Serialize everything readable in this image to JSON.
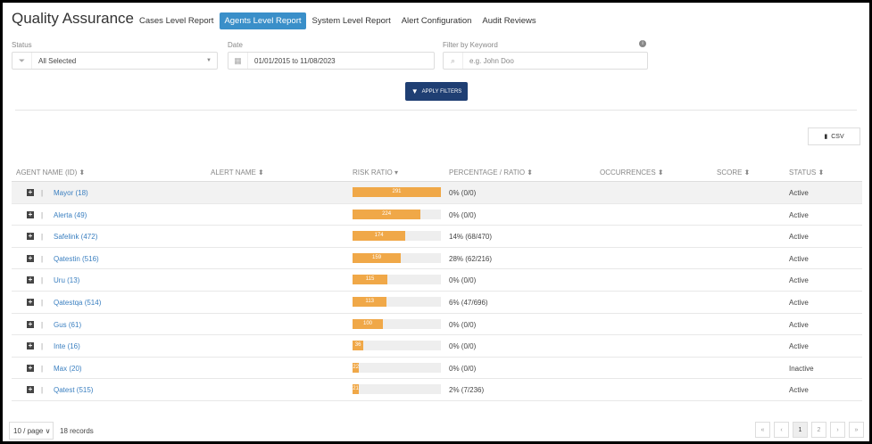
{
  "header": {
    "title": "Quality Assurance",
    "tabs": [
      {
        "label": "Cases Level Report"
      },
      {
        "label": "Agents Level Report",
        "active": true
      },
      {
        "label": "System Level Report"
      },
      {
        "label": "Alert Configuration"
      },
      {
        "label": "Audit Reviews"
      }
    ]
  },
  "filters": {
    "status_label": "Status",
    "status_value": "All Selected",
    "date_label": "Date",
    "date_value": "01/01/2015 to 11/08/2023",
    "keyword_label": "Filter by Keyword",
    "keyword_placeholder": "e.g. John Doo",
    "apply_label": "APPLY FILTERS",
    "info_icon": "i"
  },
  "csv_label": "CSV",
  "table": {
    "columns": [
      "AGENT NAME (ID) ⬍",
      "ALERT NAME ⬍",
      "RISK RATIO ▾",
      "PERCENTAGE / RATIO ⬍",
      "OCCURRENCES ⬍",
      "SCORE ⬍",
      "STATUS ⬍"
    ],
    "max_risk": 291,
    "rows": [
      {
        "agent": "Mayor (18)",
        "risk": 291,
        "pct": "0% (0/0)",
        "status": "Active"
      },
      {
        "agent": "Alerta (49)",
        "risk": 224,
        "pct": "0% (0/0)",
        "status": "Active"
      },
      {
        "agent": "Safelink (472)",
        "risk": 174,
        "pct": "14% (68/470)",
        "status": "Active"
      },
      {
        "agent": "Qatestin (516)",
        "risk": 159,
        "pct": "28% (62/216)",
        "status": "Active"
      },
      {
        "agent": "Uru (13)",
        "risk": 115,
        "pct": "0% (0/0)",
        "status": "Active"
      },
      {
        "agent": "Qatestqa (514)",
        "risk": 113,
        "pct": "6% (47/696)",
        "status": "Active"
      },
      {
        "agent": "Gus (61)",
        "risk": 100,
        "pct": "0% (0/0)",
        "status": "Active"
      },
      {
        "agent": "Inte (16)",
        "risk": 36,
        "pct": "0% (0/0)",
        "status": "Active"
      },
      {
        "agent": "Max (20)",
        "risk": 22,
        "pct": "0% (0/0)",
        "status": "Inactive"
      },
      {
        "agent": "Qatest (515)",
        "risk": 21,
        "pct": "2% (7/236)",
        "status": "Active"
      }
    ]
  },
  "footer": {
    "page_size": "10 / page ∨",
    "records": "18 records",
    "pages": [
      "«",
      "‹",
      "1",
      "2",
      "›",
      "»"
    ],
    "current_page": "1"
  }
}
